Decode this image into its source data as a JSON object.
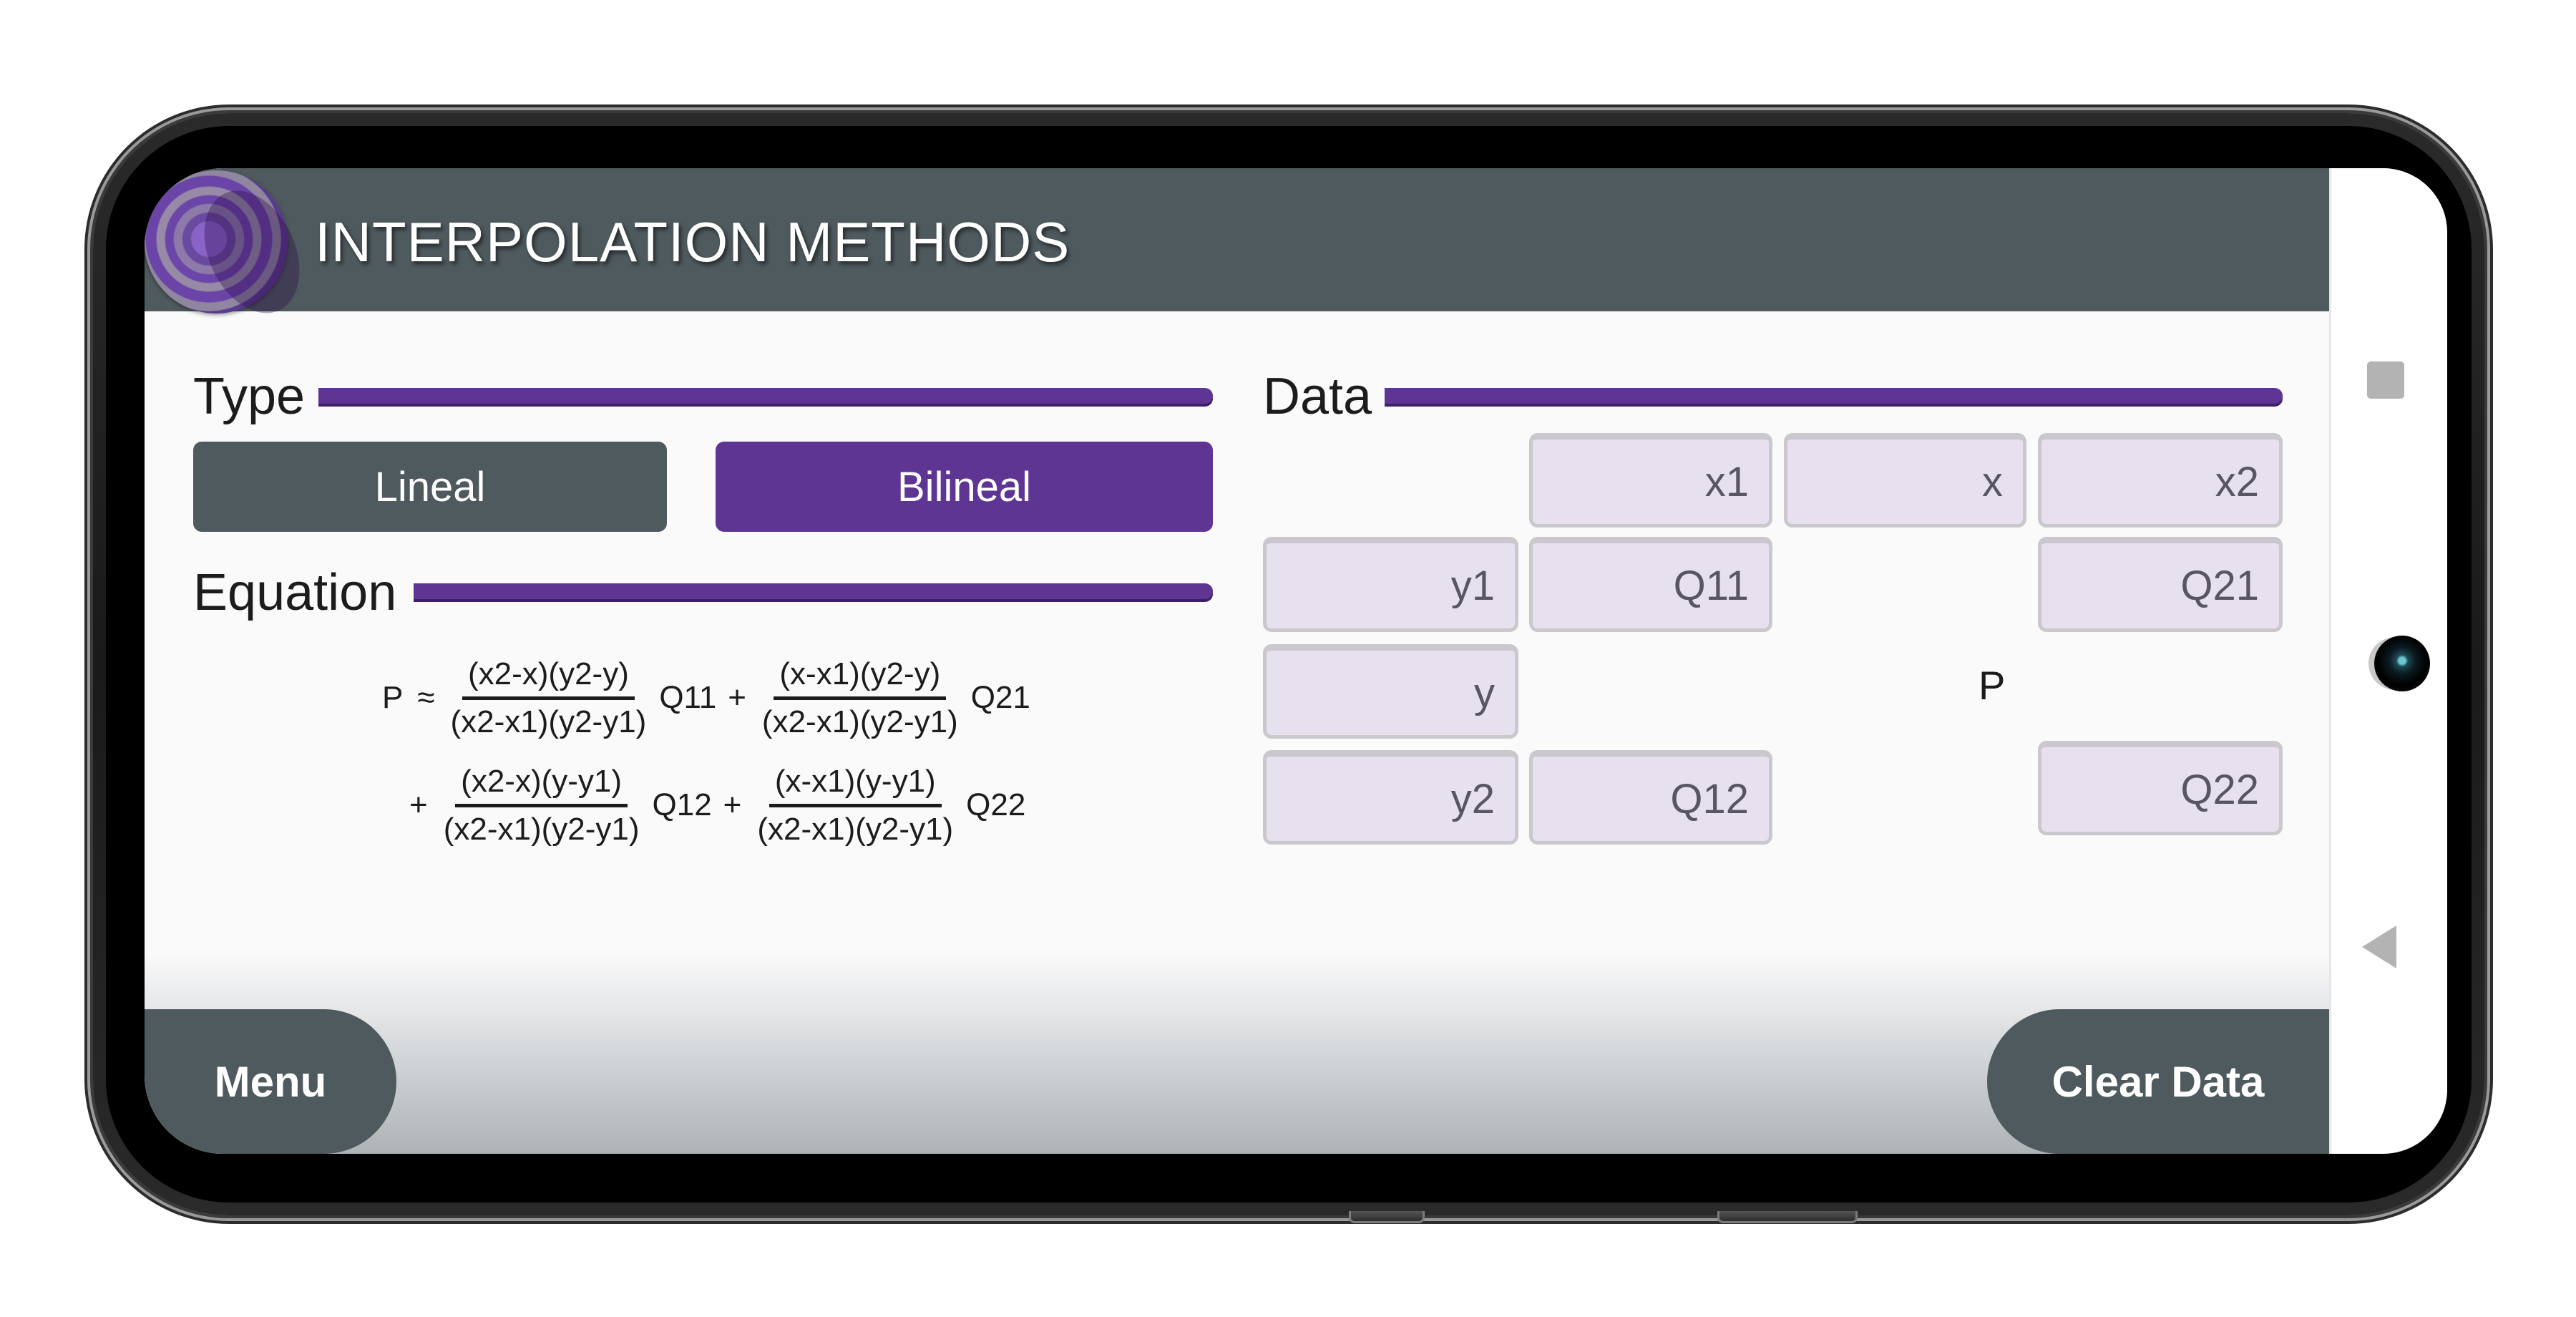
{
  "header": {
    "title": "INTERPOLATION METHODS",
    "logo": "purple-lens-logo"
  },
  "type_section": {
    "label": "Type",
    "options": [
      {
        "label": "Lineal",
        "selected": false
      },
      {
        "label": "Bilineal",
        "selected": true
      }
    ]
  },
  "equation_section": {
    "label": "Equation",
    "lhs": "P",
    "approx": "≈",
    "plus": "+",
    "terms": [
      {
        "numerator": "(x2-x)(y2-y)",
        "denominator": "(x2-x1)(y2-y1)",
        "coef": "Q11"
      },
      {
        "numerator": "(x-x1)(y2-y)",
        "denominator": "(x2-x1)(y2-y1)",
        "coef": "Q21"
      },
      {
        "numerator": "(x2-x)(y-y1)",
        "denominator": "(x2-x1)(y2-y1)",
        "coef": "Q12"
      },
      {
        "numerator": "(x-x1)(y-y1)",
        "denominator": "(x2-x1)(y2-y1)",
        "coef": "Q22"
      }
    ]
  },
  "data_section": {
    "label": "Data",
    "fields": {
      "x1": {
        "placeholder": "x1",
        "value": ""
      },
      "x": {
        "placeholder": "x",
        "value": ""
      },
      "x2": {
        "placeholder": "x2",
        "value": ""
      },
      "y1": {
        "placeholder": "y1",
        "value": ""
      },
      "q11": {
        "placeholder": "Q11",
        "value": ""
      },
      "q21": {
        "placeholder": "Q21",
        "value": ""
      },
      "y": {
        "placeholder": "y",
        "value": ""
      },
      "y2": {
        "placeholder": "y2",
        "value": ""
      },
      "q12": {
        "placeholder": "Q12",
        "value": ""
      },
      "q22": {
        "placeholder": "Q22",
        "value": ""
      }
    },
    "result_label": "P"
  },
  "footer": {
    "menu_label": "Menu",
    "clear_label": "Clear Data"
  },
  "system_nav": {
    "recents_icon": "square-icon",
    "back_icon": "back-triangle-icon"
  },
  "colors": {
    "header": "#4f5a5e",
    "accent": "#5f3594",
    "field_bg": "#e6e0ef",
    "button_dark": "#4f5a5e"
  }
}
